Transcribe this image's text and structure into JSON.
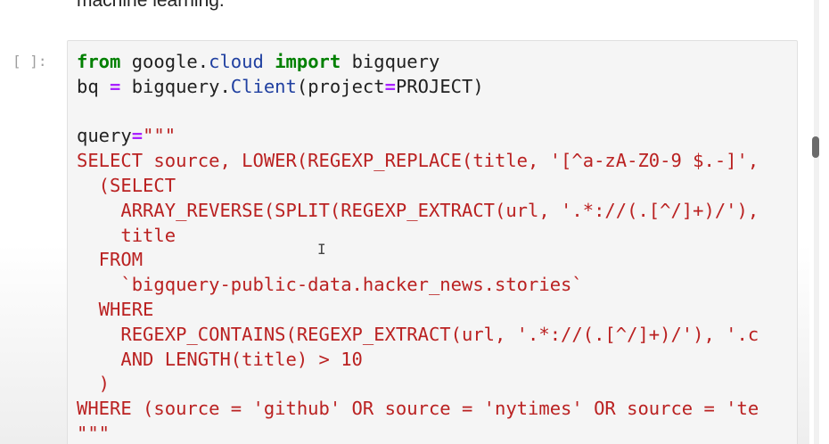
{
  "previous_markdown": {
    "text": "machine learning."
  },
  "cell": {
    "prompt": "[ ]:",
    "lines": [
      [
        {
          "t": "from",
          "c": "kw"
        },
        {
          "t": " google.",
          "c": "plain"
        },
        {
          "t": "cloud",
          "c": "attr"
        },
        {
          "t": " ",
          "c": "plain"
        },
        {
          "t": "import",
          "c": "kw"
        },
        {
          "t": " bigquery",
          "c": "plain"
        }
      ],
      [
        {
          "t": "bq ",
          "c": "plain"
        },
        {
          "t": "=",
          "c": "op"
        },
        {
          "t": " bigquery.",
          "c": "plain"
        },
        {
          "t": "Client",
          "c": "attr"
        },
        {
          "t": "(project",
          "c": "plain"
        },
        {
          "t": "=",
          "c": "op"
        },
        {
          "t": "PROJECT)",
          "c": "plain"
        }
      ],
      [
        {
          "t": "",
          "c": "plain"
        }
      ],
      [
        {
          "t": "query",
          "c": "plain"
        },
        {
          "t": "=",
          "c": "op"
        },
        {
          "t": "\"\"\"",
          "c": "str"
        }
      ],
      [
        {
          "t": "SELECT source, LOWER(REGEXP_REPLACE(title, '[^a-zA-Z0-9 $.-]',",
          "c": "str"
        }
      ],
      [
        {
          "t": "  (SELECT",
          "c": "str"
        }
      ],
      [
        {
          "t": "    ARRAY_REVERSE(SPLIT(REGEXP_EXTRACT(url, '.*://(.[^/]+)/'),",
          "c": "str"
        }
      ],
      [
        {
          "t": "    title",
          "c": "str"
        }
      ],
      [
        {
          "t": "  FROM",
          "c": "str"
        }
      ],
      [
        {
          "t": "    `bigquery-public-data.hacker_news.stories`",
          "c": "str"
        }
      ],
      [
        {
          "t": "  WHERE",
          "c": "str"
        }
      ],
      [
        {
          "t": "    REGEXP_CONTAINS(REGEXP_EXTRACT(url, '.*://(.[^/]+)/'), '.c",
          "c": "str"
        }
      ],
      [
        {
          "t": "    AND LENGTH(title) > 10",
          "c": "str"
        }
      ],
      [
        {
          "t": "  )",
          "c": "str"
        }
      ],
      [
        {
          "t": "WHERE (source = 'github' OR source = 'nytimes' OR source = 'te",
          "c": "str"
        }
      ],
      [
        {
          "t": "\"\"\"",
          "c": "str"
        }
      ]
    ]
  },
  "colors": {
    "keyword": "#008000",
    "string": "#ba2121",
    "operator": "#aa22ff",
    "attribute": "#1f3fa0",
    "cell_background": "#f5f5f5"
  },
  "icons": {
    "cursor": "text-cursor-icon"
  }
}
